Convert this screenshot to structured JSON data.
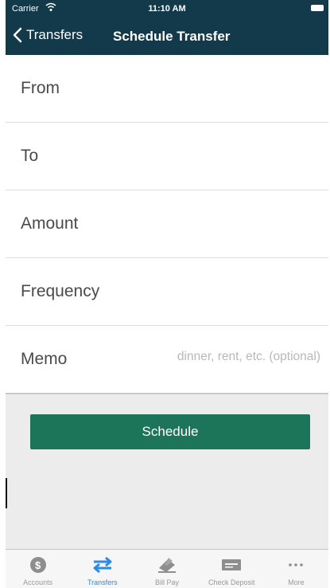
{
  "status_bar": {
    "carrier": "Carrier",
    "time": "11:10 AM"
  },
  "nav": {
    "back_label": "Transfers",
    "title": "Schedule Transfer"
  },
  "form": {
    "fields": [
      {
        "label": "From"
      },
      {
        "label": "To"
      },
      {
        "label": "Amount"
      },
      {
        "label": "Frequency"
      },
      {
        "label": "Memo",
        "placeholder": "dinner, rent, etc. (optional)"
      }
    ]
  },
  "schedule_button": {
    "label": "Schedule"
  },
  "tabs": [
    {
      "label": "Accounts",
      "icon": "dollar-icon",
      "active": false
    },
    {
      "label": "Transfers",
      "icon": "transfer-arrows-icon",
      "active": true
    },
    {
      "label": "Bill Pay",
      "icon": "bill-pay-icon",
      "active": false
    },
    {
      "label": "Check Deposit",
      "icon": "check-deposit-icon",
      "active": false
    },
    {
      "label": "More",
      "icon": "more-dots-icon",
      "active": false
    }
  ],
  "colors": {
    "header_bg": "#123a4a",
    "button_bg": "#1c7559",
    "active_tab": "#2a8be8",
    "inactive_tab": "#999999"
  }
}
